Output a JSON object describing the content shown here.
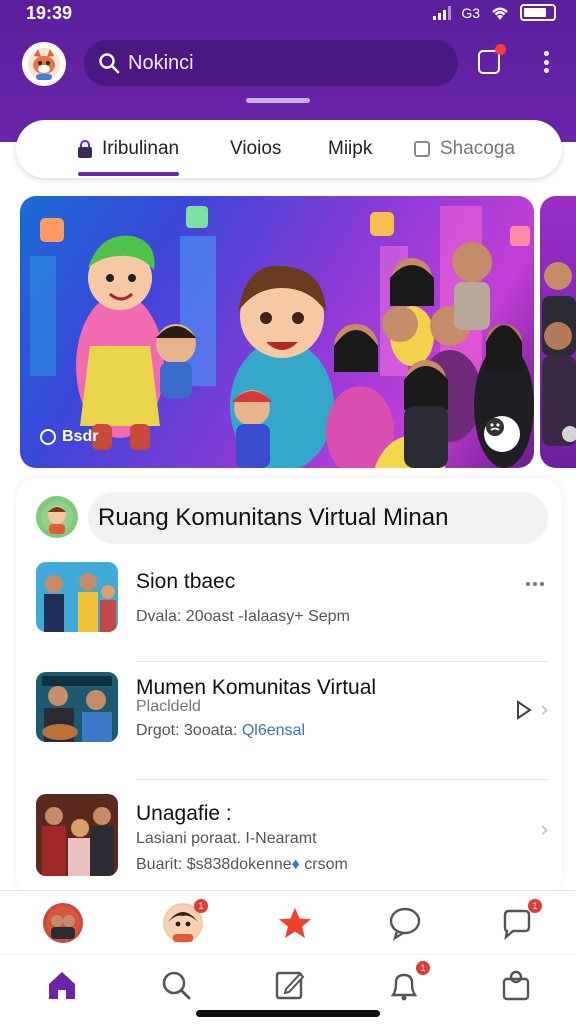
{
  "status_bar": {
    "time": "19:39",
    "carrier": "G3",
    "battery_percent": 80
  },
  "search": {
    "placeholder": "Nokinci"
  },
  "header": {
    "notification_dot": true
  },
  "tabs": [
    {
      "label": "Iribulinan",
      "active": true,
      "icon": "lock-icon"
    },
    {
      "label": "Vioios",
      "active": false
    },
    {
      "label": "Miipk",
      "active": false
    },
    {
      "label": "Shacoga",
      "active": false,
      "icon": "square-icon"
    }
  ],
  "banner": {
    "brand": "Bsdr"
  },
  "community": {
    "title": "Ruang Komunitans Virtual Minan",
    "items": [
      {
        "title": "Sion tbaec",
        "meta": "Dvala: 20oast -Ialaasy+ Sepm",
        "action": "more-dots-icon"
      },
      {
        "title": "Mumen Komunitas Virtual",
        "sub": "Placldeld",
        "meta_prefix": "Drgot: 3ooata: ",
        "meta_accent": "Ql6ensal",
        "action": "play-icon"
      },
      {
        "title": "Unagafie :",
        "sub": "Lasiani poraat. I-Nearamt",
        "meta_prefix": "Buarit: ",
        "meta_accent": "$s838dokenne",
        "meta_suffix": " crsom",
        "action": "chevron-right-icon"
      }
    ]
  },
  "story_badges": [
    "1",
    "1"
  ],
  "nav_badge": "1",
  "colors": {
    "primary": "#6a25ab",
    "primary_dark": "#4b1881",
    "accent_red": "#e53935",
    "link_blue": "#3a72c9"
  }
}
